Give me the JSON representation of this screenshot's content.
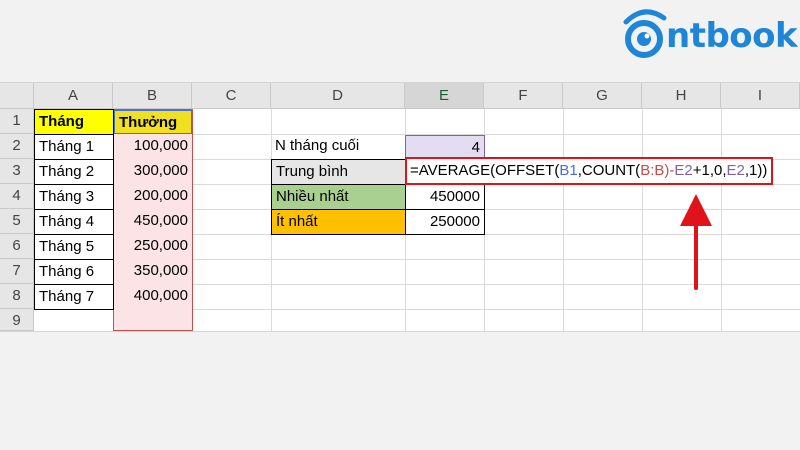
{
  "brand": {
    "logo_text": "ntbook",
    "logo_color": "#1d86d8"
  },
  "columns": [
    "A",
    "B",
    "C",
    "D",
    "E",
    "F",
    "G",
    "H",
    "I"
  ],
  "rows": [
    "1",
    "2",
    "3",
    "4",
    "5",
    "6",
    "7",
    "8",
    "9"
  ],
  "table": {
    "header_month": "Tháng",
    "header_bonus": "Thưởng",
    "months": [
      "Tháng 1",
      "Tháng 2",
      "Tháng 3",
      "Tháng 4",
      "Tháng 5",
      "Tháng 6",
      "Tháng 7"
    ],
    "bonuses": [
      "100,000",
      "300,000",
      "200,000",
      "450,000",
      "250,000",
      "350,000",
      "400,000"
    ]
  },
  "summary": {
    "n_label": "N tháng cuối",
    "n_value": "4",
    "avg_label": "Trung bình",
    "max_label": "Nhiều nhất",
    "max_value": "450000",
    "min_label": "Ít nhất",
    "min_value": "250000"
  },
  "formula": {
    "part1": "=AVERAGE(OFFSET(",
    "ref1": "B1",
    "part2": ",COUNT(",
    "ref2": "B:B",
    "part3": ")-",
    "ref3": "E2",
    "part4": "+1,0,",
    "ref4": "E2",
    "part5": ",1))"
  },
  "colors": {
    "header_yellow": "#ffff00",
    "bonus_header_yellow": "#f0e020",
    "range_pink": "#fce4e6",
    "n_purple": "#e4dcf0",
    "avg_gray": "#e7e6e6",
    "max_green": "#a9d08e",
    "min_orange": "#ffc000",
    "ref_blue": "#4a6fd1",
    "ref_red": "#c0504d",
    "ref_purple": "#8064a2",
    "highlight_red": "#e0121a"
  }
}
